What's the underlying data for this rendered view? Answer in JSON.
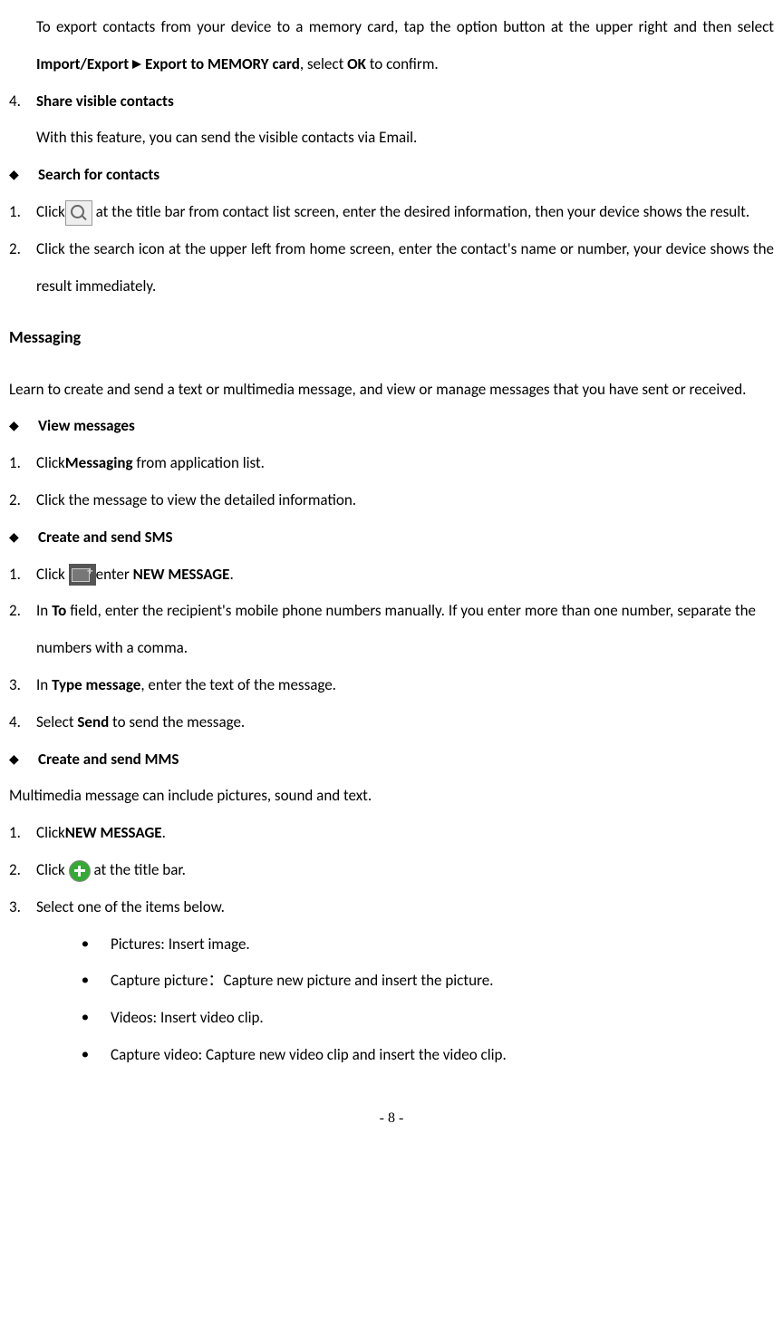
{
  "export_para_1": "To export contacts from your device to a memory card, tap the option button at the upper right and then select ",
  "export_bold_1": "Import/Export",
  "export_bold_2": "Export to MEMORY card",
  "export_mid": ", select ",
  "export_bold_3": "OK",
  "export_after": " to confirm.",
  "item4_num": "4.",
  "item4_title": "Share visible contacts",
  "item4_text": "With this feature, you can send the visible contacts via Email.",
  "search_title": "Search for contacts",
  "search_1_num": "1.",
  "search_1_a": "Click",
  "search_1_b": "  at the title bar from contact list screen, enter the desired information, then your device shows the result.",
  "search_2_num": "2.",
  "search_2": "Click the search icon at the upper left from home screen, enter the contact's name or number, your device shows the result immediately.",
  "messaging_heading": "Messaging",
  "messaging_intro": "Learn to create and send a text or multimedia message, and view or manage messages that you have sent or received.",
  "view_title": "View messages",
  "view_1_num": "1.",
  "view_1_a": "Click",
  "view_1_bold": "Messaging",
  "view_1_b": " from application list.",
  "view_2_num": "2.",
  "view_2": "Click the message to view the detailed information.",
  "sms_title": "Create and send SMS",
  "sms_1_num": "1.",
  "sms_1_a": "Click  ",
  "sms_1_enter": "enter ",
  "sms_1_bold": "NEW MESSAGE",
  "sms_1_dot": ".",
  "sms_2_num": "2.",
  "sms_2_a": "In ",
  "sms_2_bold": "To",
  "sms_2_b": " field, enter the recipient's mobile phone numbers manually. If you enter more than one number, separate the numbers with a comma.",
  "sms_3_num": "3.",
  "sms_3_a": "In ",
  "sms_3_bold": "Type message",
  "sms_3_b": ", enter the text of the message.",
  "sms_4_num": "4.",
  "sms_4_a": "Select ",
  "sms_4_bold": "Send",
  "sms_4_b": " to send the message.",
  "mms_title": "Create and send MMS",
  "mms_intro": "Multimedia message can include pictures, sound and text.",
  "mms_1_num": "1.",
  "mms_1_a": "Click",
  "mms_1_bold": "NEW MESSAGE",
  "mms_1_dot": ".",
  "mms_2_num": "2.",
  "mms_2_a": "Click ",
  "mms_2_b": "  at the title bar.",
  "mms_3_num": "3.",
  "mms_3": "Select one of the items below.",
  "bullet_1": "Pictures: Insert image.",
  "bullet_2a": "Capture picture",
  "bullet_2_colon": "：",
  "bullet_2b": "Capture new picture and insert the picture.",
  "bullet_3": "Videos: Insert video clip.",
  "bullet_4": "Capture video: Capture new video clip and insert the video clip.",
  "footer": "- 8 -"
}
